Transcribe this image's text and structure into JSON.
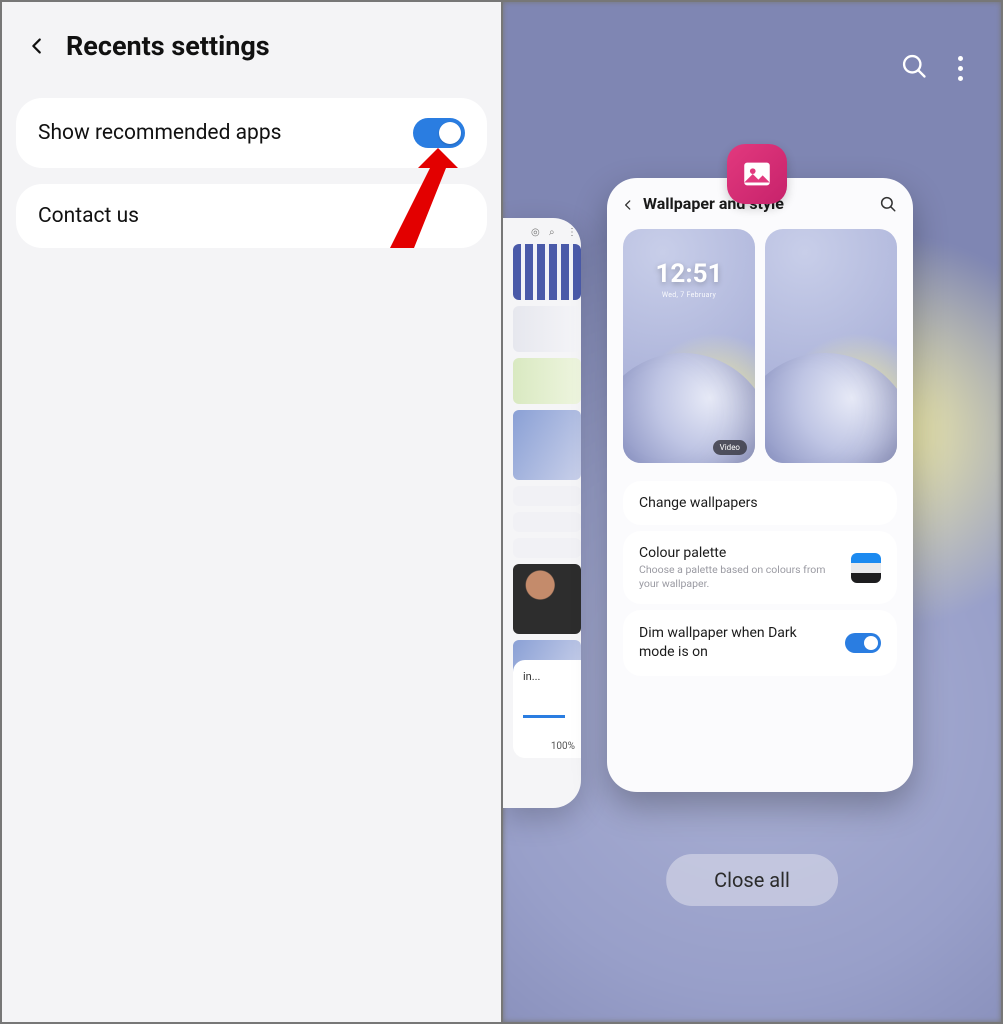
{
  "left": {
    "title": "Recents settings",
    "items": [
      {
        "label": "Show recommended apps",
        "toggle_on": true
      },
      {
        "label": "Contact us"
      }
    ]
  },
  "right": {
    "close_all_label": "Close all",
    "prev_card": {
      "status_label": "in...",
      "progress_pct": "100%"
    },
    "main_card": {
      "header_title": "Wallpaper and style",
      "wallpapers": {
        "clock": "12:51",
        "date": "Wed, 7 February",
        "video_badge": "Video"
      },
      "change_wallpapers_label": "Change wallpapers",
      "colour_palette": {
        "title": "Colour palette",
        "subtitle": "Choose a palette based on colours from your wallpaper."
      },
      "dim_label": "Dim wallpaper when Dark mode is on"
    },
    "app_chip_icon": "gallery-icon"
  }
}
